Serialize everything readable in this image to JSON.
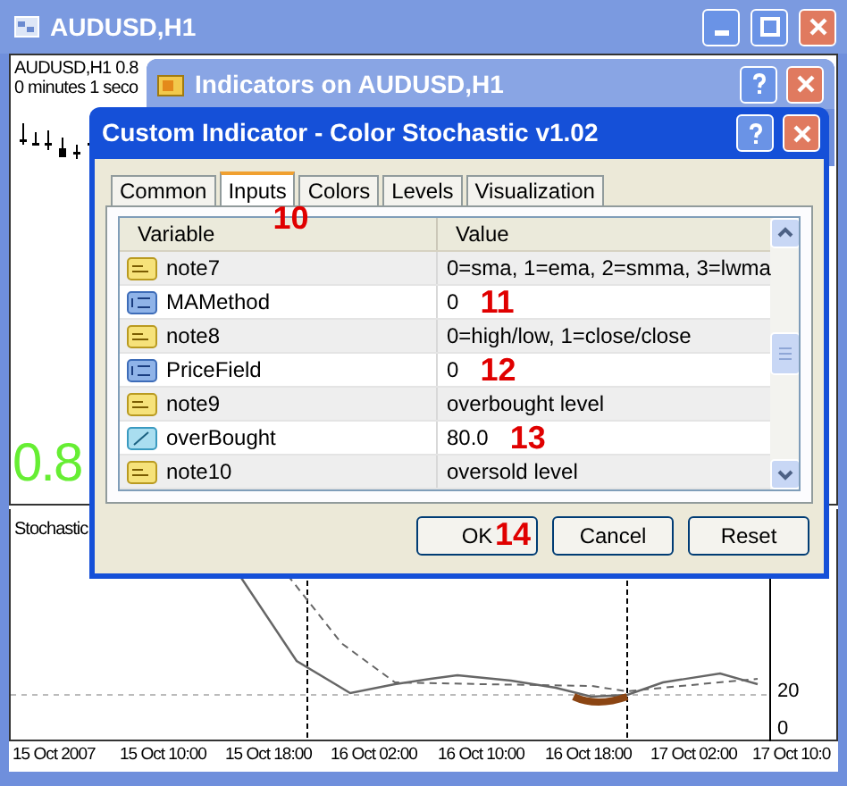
{
  "window": {
    "title": "AUDUSD,H1"
  },
  "chart": {
    "symbol_line": "AUDUSD,H1  0.8",
    "timer_line": "0 minutes 1 seco",
    "big_price": "0.8"
  },
  "stochastic": {
    "label": "Stochastic",
    "y_labels": [
      "20",
      "0"
    ],
    "x_labels": [
      "15 Oct 2007",
      "15 Oct 10:00",
      "15 Oct 18:00",
      "16 Oct 02:00",
      "16 Oct 10:00",
      "16 Oct 18:00",
      "17 Oct 02:00",
      "17 Oct 10:0"
    ]
  },
  "indicators_window": {
    "title": "Indicators on AUDUSD,H1"
  },
  "dialog": {
    "title": "Custom Indicator - Color Stochastic v1.02",
    "tabs": [
      {
        "label": "Common",
        "selected": false
      },
      {
        "label": "Inputs",
        "selected": true,
        "annotation": "10"
      },
      {
        "label": "Colors",
        "selected": false
      },
      {
        "label": "Levels",
        "selected": false
      },
      {
        "label": "Visualization",
        "selected": false
      }
    ],
    "table": {
      "columns": [
        "Variable",
        "Value"
      ],
      "rows": [
        {
          "kind": "string",
          "variable": "note7",
          "value": "0=sma, 1=ema, 2=smma, 3=lwma"
        },
        {
          "kind": "int",
          "variable": "MAMethod",
          "value": "0",
          "annotation": "11"
        },
        {
          "kind": "string",
          "variable": "note8",
          "value": "0=high/low, 1=close/close"
        },
        {
          "kind": "int",
          "variable": "PriceField",
          "value": "0",
          "annotation": "12"
        },
        {
          "kind": "string",
          "variable": "note9",
          "value": "overbought level"
        },
        {
          "kind": "double",
          "variable": "overBought",
          "value": "80.0",
          "annotation": "13"
        },
        {
          "kind": "string",
          "variable": "note10",
          "value": "oversold level"
        }
      ]
    },
    "buttons": [
      {
        "label": "OK",
        "annotation": "14"
      },
      {
        "label": "Cancel"
      },
      {
        "label": "Reset"
      }
    ]
  }
}
